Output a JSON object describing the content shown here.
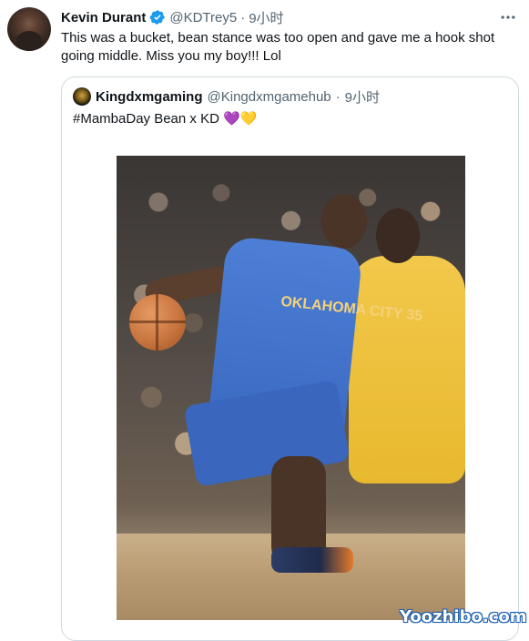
{
  "tweet": {
    "author_name": "Kevin Durant",
    "handle": "@KDTrey5",
    "dot": "·",
    "time": "9小时",
    "text": "This was a bucket, bean stance was too open and gave me a hook shot going middle. Miss you my boy!!! Lol",
    "more_icon": "more-horizontal-icon"
  },
  "quote": {
    "author_name": "Kingdxmgaming",
    "handle": "@Kingdxmgamehub",
    "dot": "·",
    "time": "9小时",
    "text": "#MambaDay Bean x KD",
    "emojis": "💜💛",
    "jersey_text": "OKLAHOMA CITY 35"
  },
  "watermark": "Yoozhibo.com",
  "colors": {
    "accent": "#1d9bf0",
    "text_primary": "#0f1419",
    "text_secondary": "#536471",
    "border": "#cfd9de"
  }
}
